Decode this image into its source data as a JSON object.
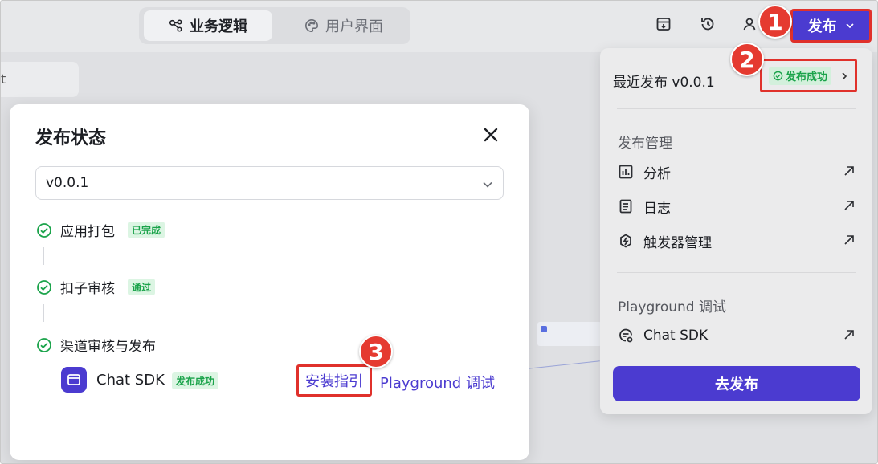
{
  "topbar": {
    "tabs": [
      {
        "label": "业务逻辑",
        "icon": "flow-nodes-icon",
        "active": true
      },
      {
        "label": "用户界面",
        "icon": "palette-icon",
        "active": false
      }
    ],
    "icons": [
      "archive-box-icon",
      "history-clock-icon",
      "user-icon"
    ],
    "publish_label": "发布"
  },
  "annotations": [
    "1",
    "2",
    "3"
  ],
  "canvas": {
    "pill_text": "t"
  },
  "modal": {
    "title": "发布状态",
    "version_select": {
      "value": "v0.0.1"
    },
    "steps": [
      {
        "label": "应用打包",
        "status": "已完成"
      },
      {
        "label": "扣子审核",
        "status": "通过"
      },
      {
        "label": "渠道审核与发布",
        "status": ""
      }
    ],
    "channel": {
      "name": "Chat SDK",
      "status": "发布成功",
      "install_link": "安装指引",
      "playground_link": "Playground 调试"
    }
  },
  "dropdown": {
    "recent_label": "最近发布 v0.0.1",
    "recent_status": "发布成功",
    "section_manage": "发布管理",
    "manage_items": [
      {
        "label": "分析",
        "icon": "bar-chart-icon"
      },
      {
        "label": "日志",
        "icon": "document-icon"
      },
      {
        "label": "触发器管理",
        "icon": "trigger-bolt-icon"
      }
    ],
    "section_playground": "Playground 调试",
    "playground_items": [
      {
        "label": "Chat SDK",
        "icon": "chat-sdk-icon"
      }
    ],
    "go_publish": "去发布"
  },
  "colors": {
    "brand": "#4b3bd0",
    "success": "#1aa34a",
    "annotation_red": "#e0312b"
  }
}
